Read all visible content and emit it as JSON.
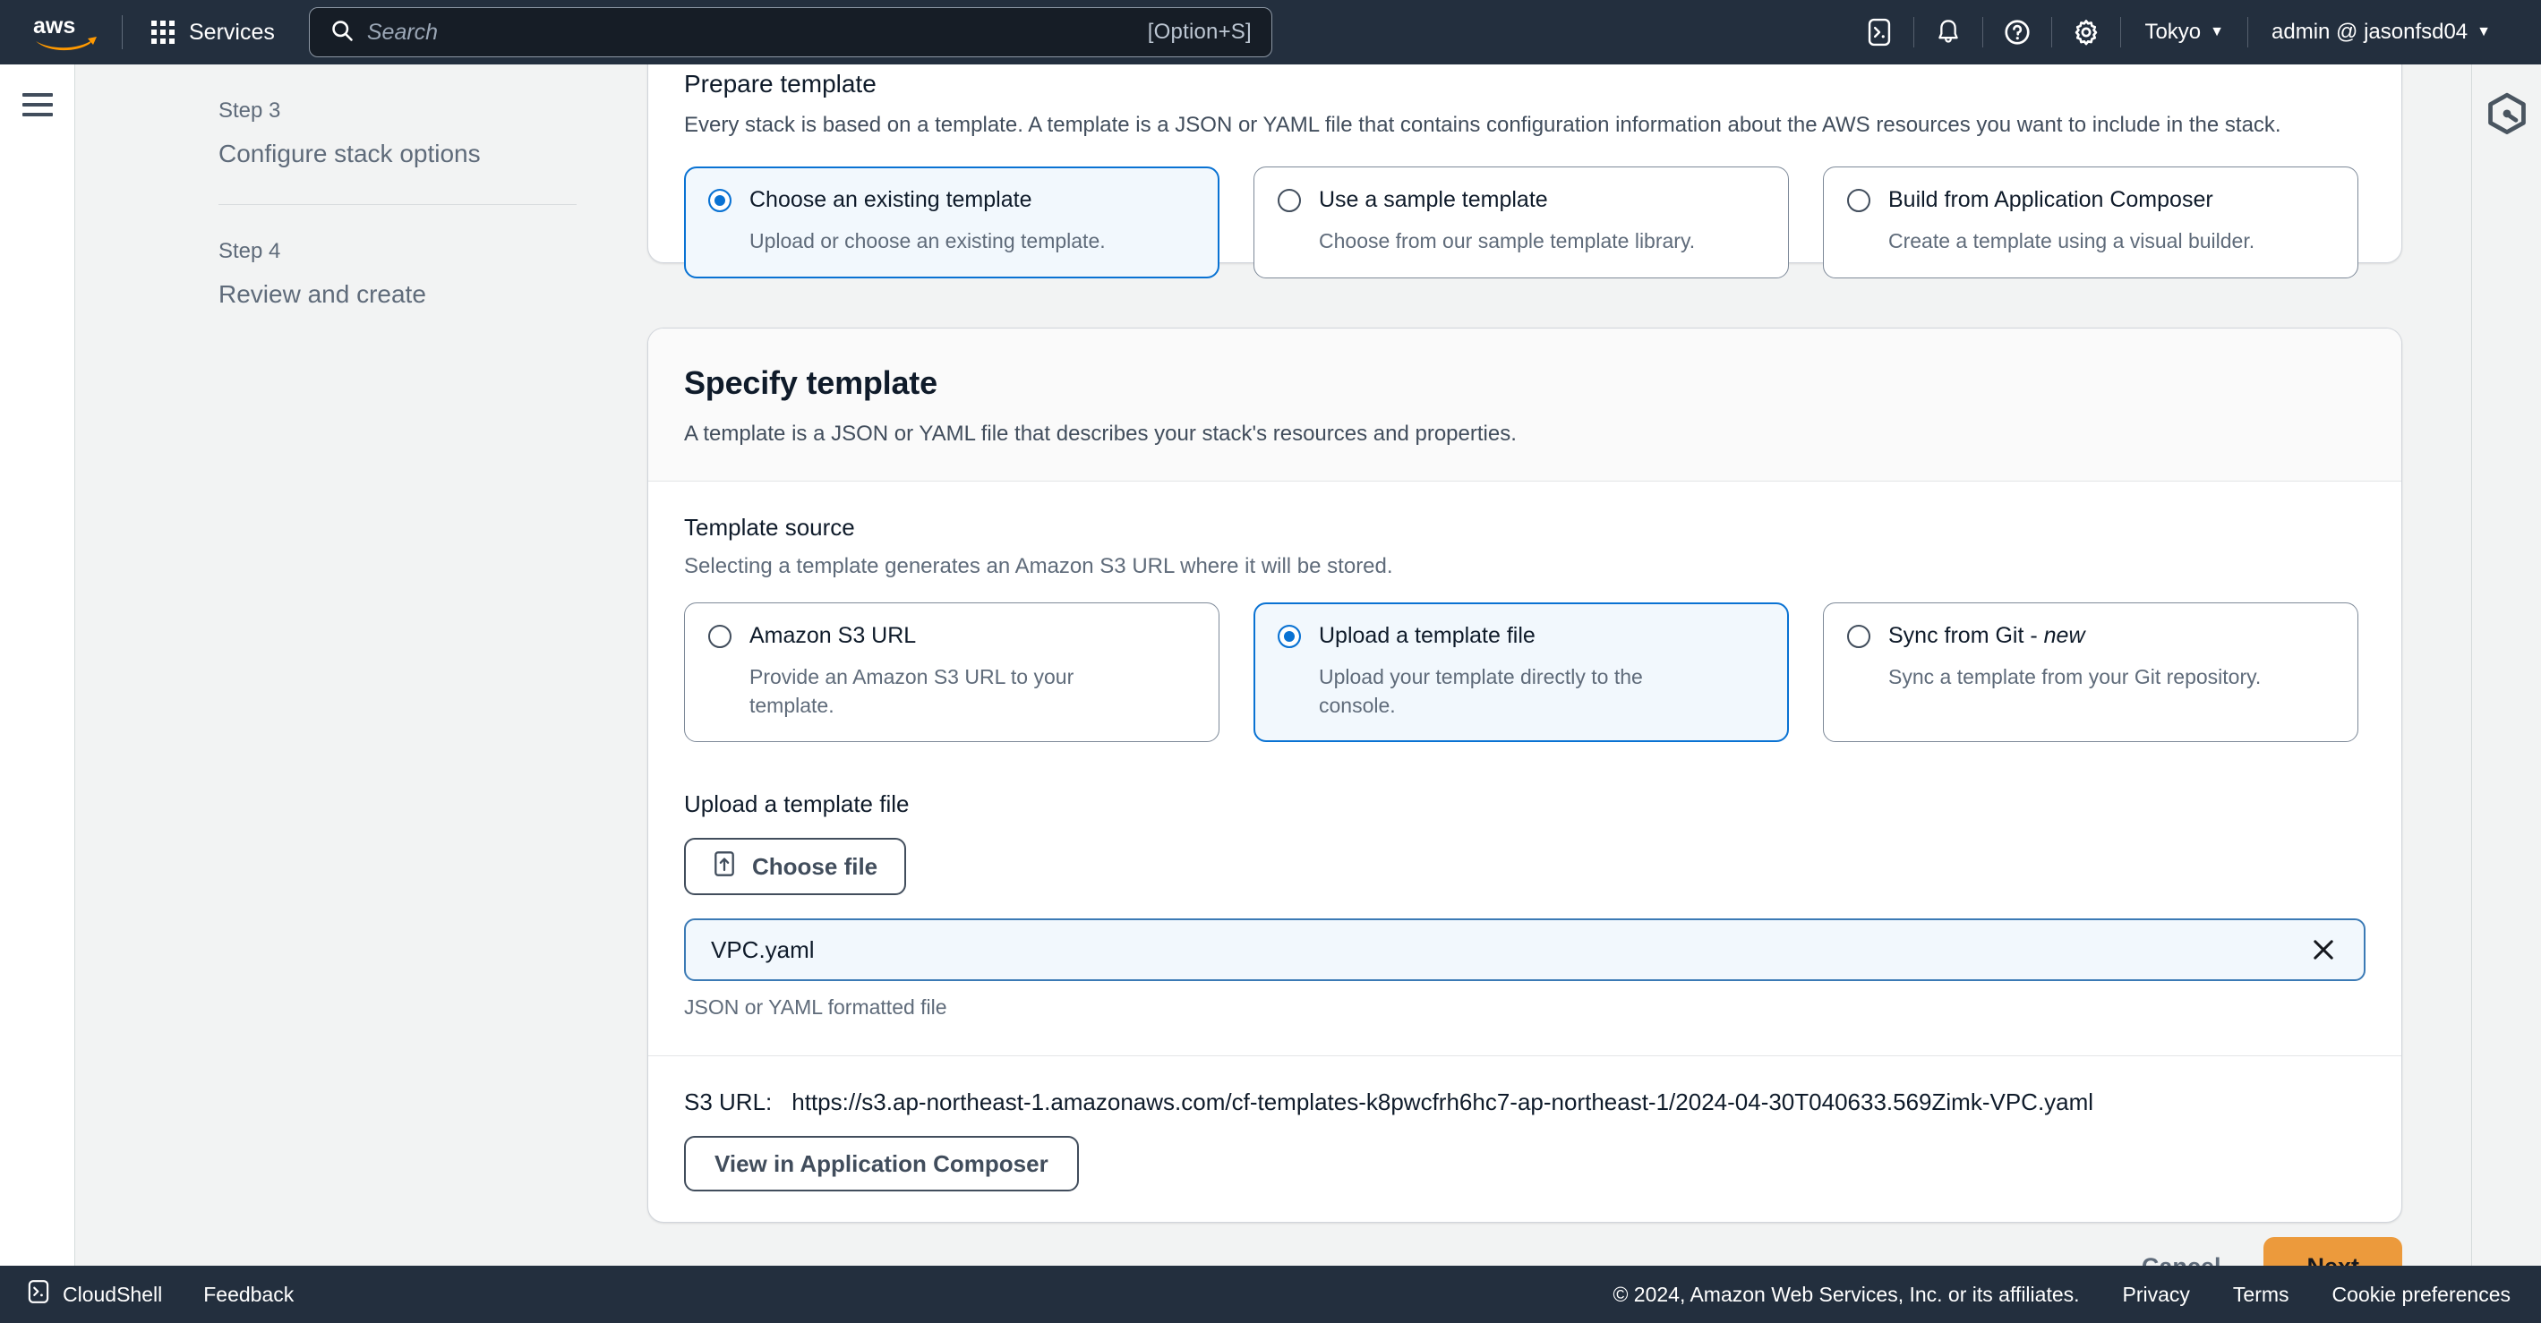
{
  "topnav": {
    "logo_alt": "aws",
    "services_label": "Services",
    "search_placeholder": "Search",
    "search_value": "",
    "search_shortcut": "[Option+S]",
    "cloudshell_icon": "terminal-icon",
    "notifications_icon": "bell-icon",
    "help_icon": "question-circle-icon",
    "settings_icon": "gear-icon",
    "region_label": "Tokyo",
    "account_label": "admin @ jasonfsd04"
  },
  "sidebar": {
    "menu_icon": "hamburger-icon",
    "steps": [
      {
        "kicker": "Step 3",
        "title": "Configure stack options"
      },
      {
        "kicker": "Step 4",
        "title": "Review and create"
      }
    ]
  },
  "prepare_template": {
    "title": "Prepare template",
    "description": "Every stack is based on a template. A template is a JSON or YAML file that contains configuration information about the AWS resources you want to include in the stack.",
    "options": [
      {
        "label": "Choose an existing template",
        "sub": "Upload or choose an existing template.",
        "selected": true
      },
      {
        "label": "Use a sample template",
        "sub": "Choose from our sample template library.",
        "selected": false
      },
      {
        "label": "Build from Application Composer",
        "sub": "Create a template using a visual builder.",
        "selected": false
      }
    ]
  },
  "specify_template": {
    "heading": "Specify template",
    "subheading": "A template is a JSON or YAML file that describes your stack's resources and properties.",
    "template_source": {
      "label": "Template source",
      "description": "Selecting a template generates an Amazon S3 URL where it will be stored.",
      "options": [
        {
          "label": "Amazon S3 URL",
          "label_italic": "",
          "sub": "Provide an Amazon S3 URL to your template.",
          "selected": false
        },
        {
          "label": "Upload a template file",
          "label_italic": "",
          "sub": "Upload your template directly to the console.",
          "selected": true
        },
        {
          "label": "Sync from Git - ",
          "label_italic": "new",
          "sub": "Sync a template from your Git repository.",
          "selected": false
        }
      ]
    },
    "upload": {
      "label": "Upload a template file",
      "choose_file_label": "Choose file",
      "choose_file_icon": "upload-icon",
      "file_value": "VPC.yaml",
      "file_placeholder": "",
      "clear_icon": "close-icon",
      "hint": "JSON or YAML formatted file"
    },
    "s3": {
      "key_label": "S3 URL:",
      "url": "https://s3.ap-northeast-1.amazonaws.com/cf-templates-k8pwcfrh6hc7-ap-northeast-1/2024-04-30T040633.569Zimk-VPC.yaml",
      "composer_button": "View in Application Composer"
    }
  },
  "actions": {
    "cancel_label": "Cancel",
    "next_label": "Next",
    "next_color": "#ec9a3c"
  },
  "info_rail": {
    "icon": "composer-hex-icon"
  },
  "footer": {
    "cloudshell_label": "CloudShell",
    "cloudshell_icon": "terminal-icon",
    "feedback_label": "Feedback",
    "copyright": "© 2024, Amazon Web Services, Inc. or its affiliates.",
    "links": [
      "Privacy",
      "Terms",
      "Cookie preferences"
    ]
  },
  "theme": {
    "nav_bg": "#232f3e",
    "page_bg": "#f2f3f3",
    "accent_blue": "#0972d3",
    "selected_tile_bg": "#f2f8fd",
    "orange": "#ec9a3c"
  }
}
